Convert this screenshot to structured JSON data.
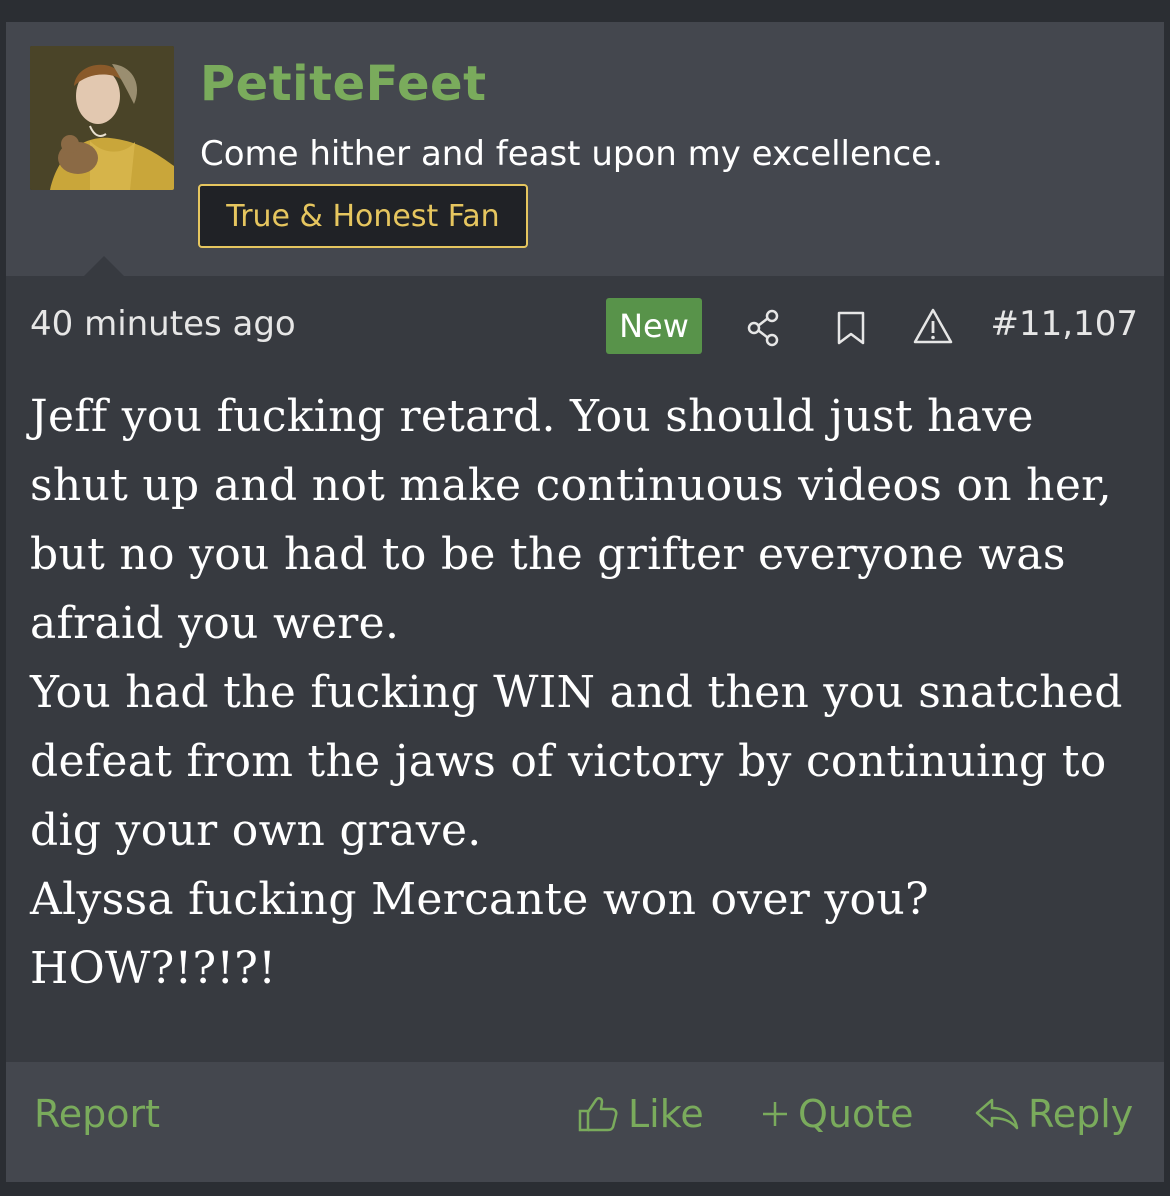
{
  "user": {
    "name": "PetiteFeet",
    "title": "Come hither and feast upon my excellence.",
    "badge": "True & Honest Fan"
  },
  "meta": {
    "time": "40 minutes ago",
    "new_label": "New",
    "post_number": "#11,107"
  },
  "message": {
    "paragraphs": [
      "Jeff you fucking retard. You should just have shut up and not make continuous videos on her, but no you had to be the grifter everyone was afraid you were.",
      "You had the fucking WIN and then you snatched defeat from the jaws of victory by continuing to dig your own grave.",
      "Alyssa fucking Mercante won over you?",
      "HOW?!?!?!"
    ]
  },
  "footer": {
    "report": "Report",
    "like": "Like",
    "quote": "Quote",
    "reply": "Reply"
  },
  "colors": {
    "accent_green": "#7aab5c",
    "badge_gold": "#e6c65f",
    "new_badge": "#58934a",
    "post_bg": "#373a40",
    "header_bg": "#44474e"
  },
  "icons": [
    "share-icon",
    "bookmark-icon",
    "warning-icon",
    "thumbs-up-icon",
    "plus-icon",
    "reply-arrow-icon"
  ]
}
